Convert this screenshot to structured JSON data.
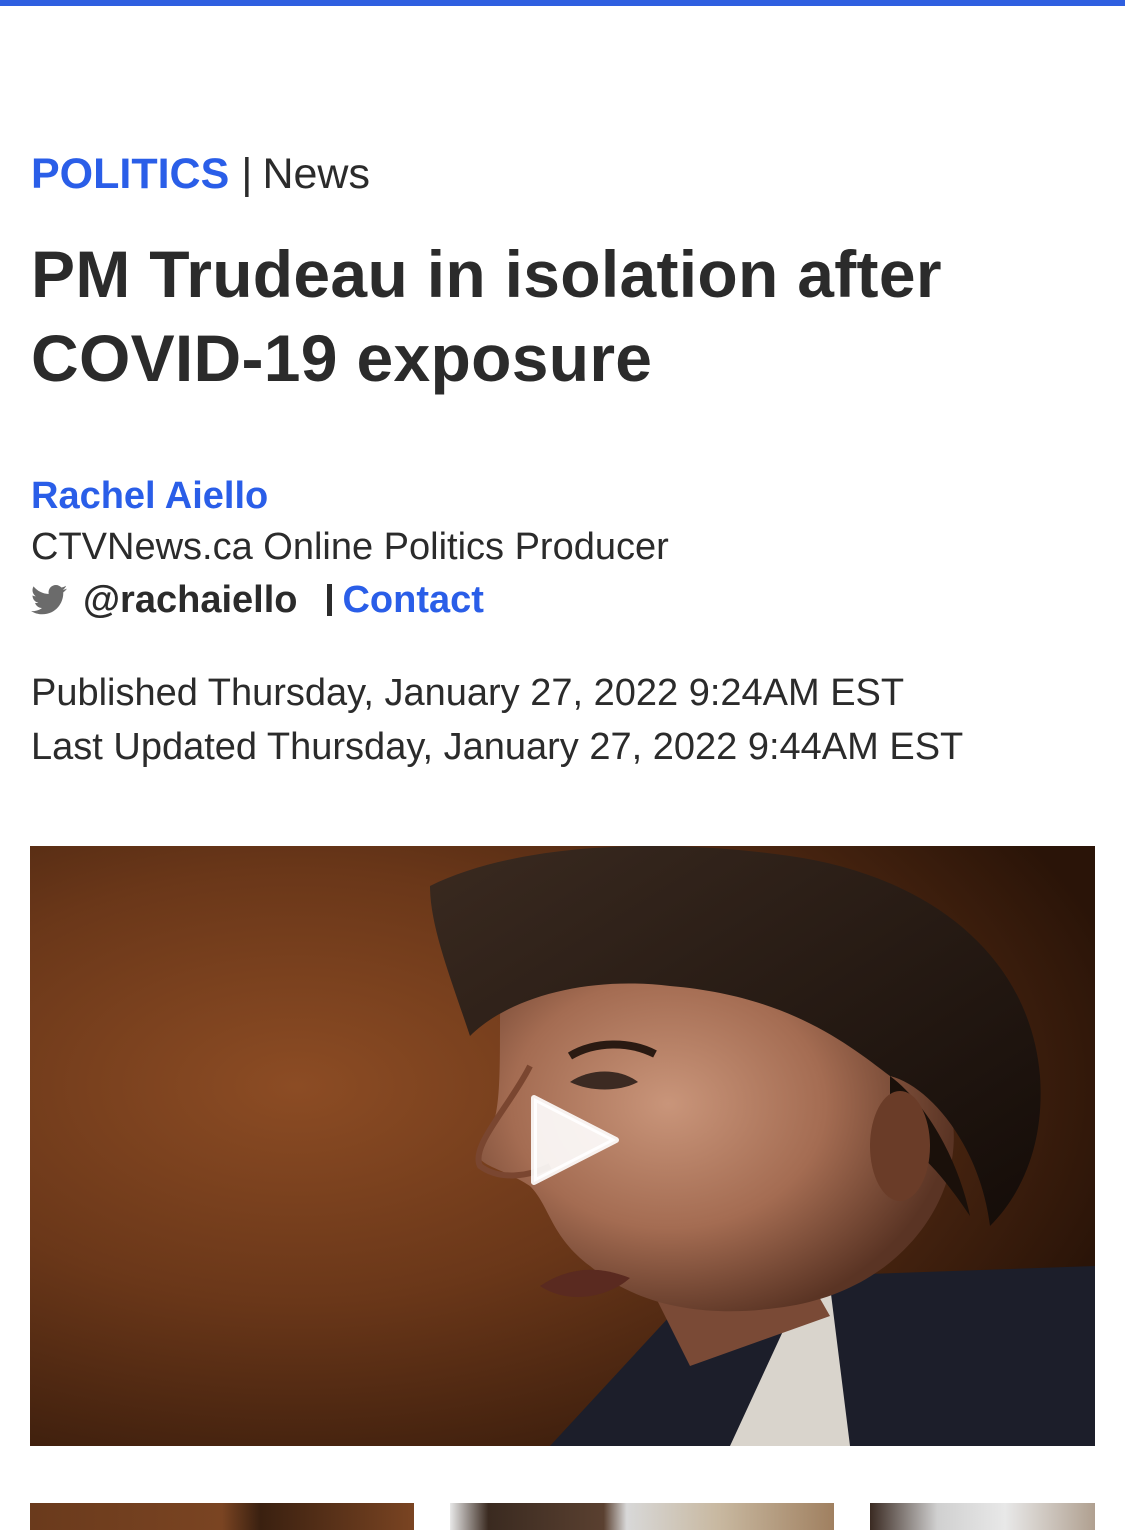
{
  "article": {
    "section": "POLITICS",
    "separator": "|",
    "subsection": "News",
    "headline": "PM Trudeau in isolation after COVID-19 exposure"
  },
  "author": {
    "name": "Rachel Aiello",
    "role": "CTVNews.ca Online Politics Producer",
    "twitter_handle": "@rachaiello",
    "contact_label": "Contact"
  },
  "dates": {
    "published": "Published Thursday, January 27, 2022 9:24AM EST",
    "updated": "Last Updated Thursday, January 27, 2022 9:44AM EST"
  },
  "media": {
    "video_thumbnail_icon": "play-icon",
    "related_thumbnails": 3
  },
  "colors": {
    "accent": "#2a5ee8",
    "progress": "#2f5fe0",
    "text": "#2b2b2b"
  }
}
